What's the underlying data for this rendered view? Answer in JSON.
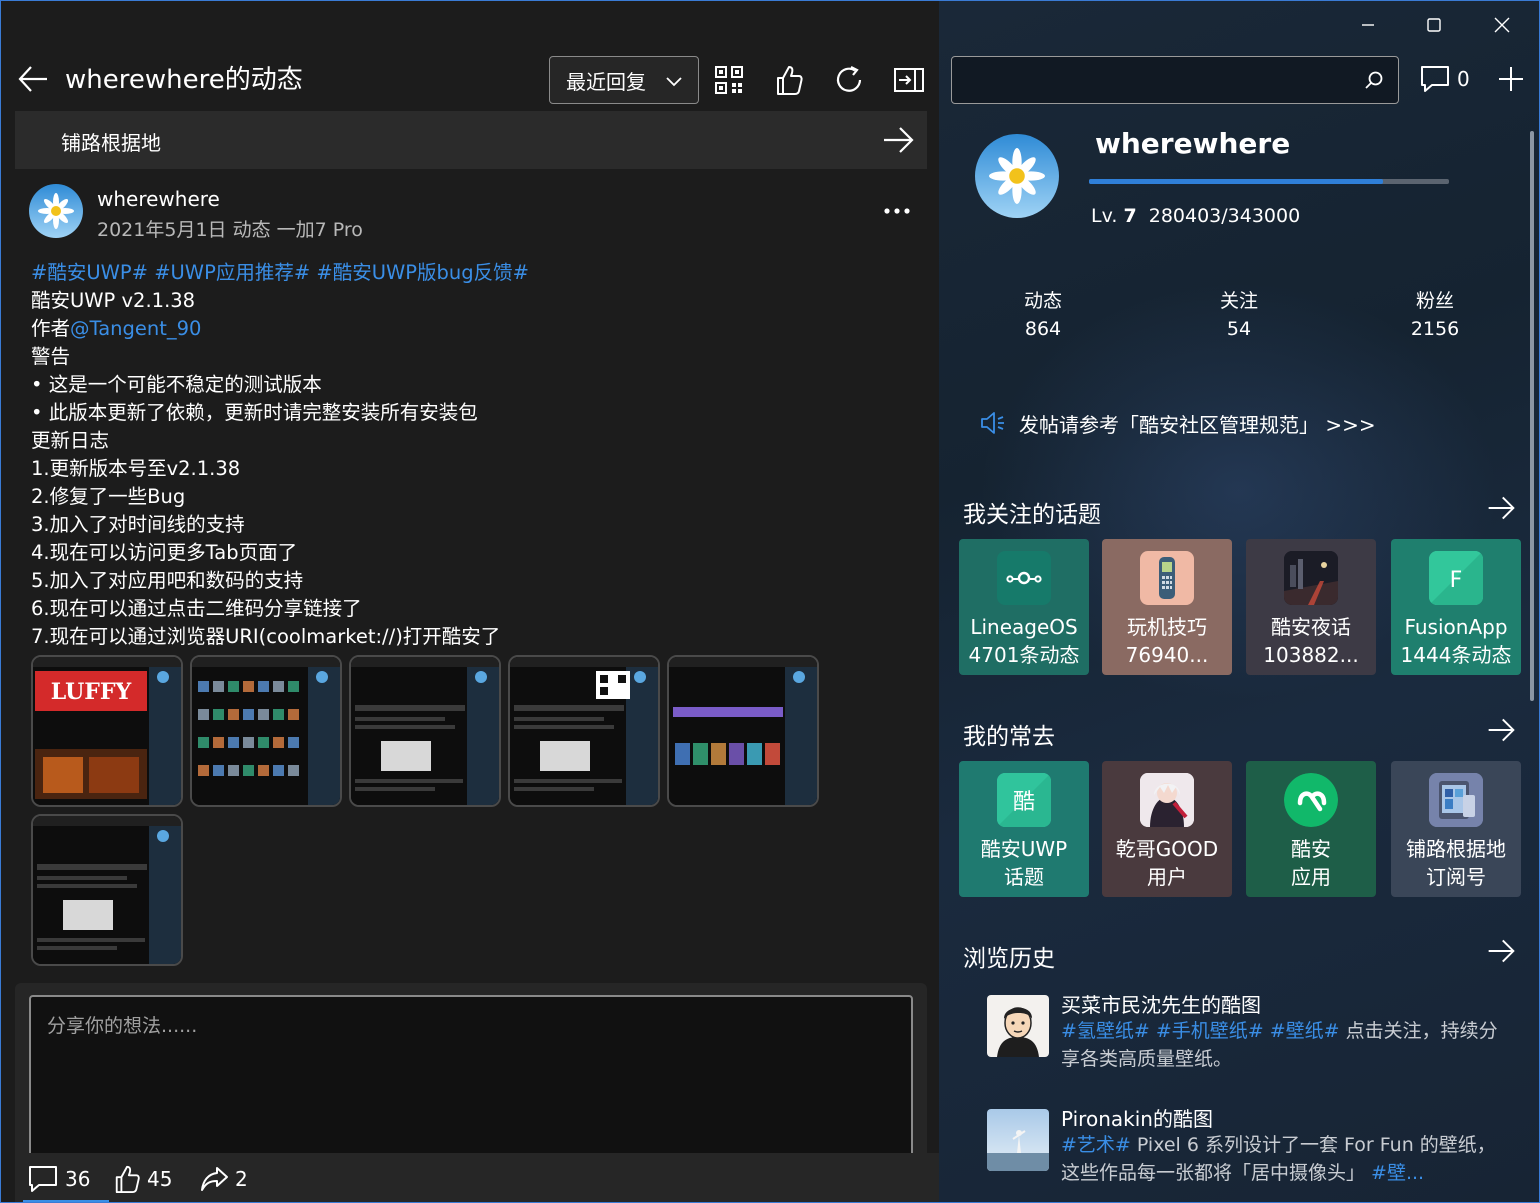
{
  "window": {
    "accent": "#3a7bd5",
    "controls": [
      "minimize",
      "maximize",
      "close"
    ]
  },
  "header": {
    "title": "wherewhere的动态",
    "sort_selected": "最近回复",
    "icons": [
      "back-arrow-icon",
      "qr-code-icon",
      "thumb-up-icon",
      "refresh-icon",
      "pane-toggle-icon"
    ]
  },
  "topic_bar": {
    "label": "铺路根据地"
  },
  "post": {
    "username": "wherewhere",
    "meta": "2021年5月1日  动态  一加7 Pro",
    "tags_line": "#酷安UWP# #UWP应用推荐# #酷安UWP版bug反馈#",
    "line_version": "酷安UWP v2.1.38",
    "author_prefix": "作者",
    "author_mention": "@Tangent_90",
    "lines": [
      "警告",
      "• 这是一个可能不稳定的测试版本",
      "• 此版本更新了依赖，更新时请完整安装所有安装包",
      "更新日志",
      "1.更新版本号至v2.1.38",
      "2.修复了一些Bug",
      "3.加入了对时间线的支持",
      "4.现在可以访问更多Tab页面了",
      "5.加入了对应用吧和数码的支持",
      "6.现在可以通过点击二维码分享链接了",
      "7.现在可以通过浏览器URI(coolmarket://)打开酷安了"
    ],
    "thumbnail_count": 6
  },
  "comment": {
    "placeholder": "分享你的想法......"
  },
  "bottom_bar": {
    "comments": "36",
    "likes": "45",
    "shares": "2"
  },
  "right": {
    "search_placeholder": "",
    "message_count": "0",
    "profile": {
      "name": "wherewhere",
      "level_label": "Lv.",
      "level": "7",
      "exp": "280403/343000",
      "exp_fraction": 0.8175
    },
    "stats": [
      {
        "label": "动态",
        "value": "864"
      },
      {
        "label": "关注",
        "value": "54"
      },
      {
        "label": "粉丝",
        "value": "2156"
      }
    ],
    "notice": "发帖请参考「酷安社区管理规范」 >>>",
    "followed_topics": {
      "title": "我关注的话题",
      "items": [
        {
          "line1": "LineageOS",
          "line2": "4701条动态",
          "color": "#1f6e64"
        },
        {
          "line1": "玩机技巧",
          "line2": "76940...",
          "color": "#8a6a62"
        },
        {
          "line1": "酷安夜话",
          "line2": "103882...",
          "color": "#3d3a45"
        },
        {
          "line1": "FusionApp",
          "line2": "1444条动态",
          "color": "#1f7f6e"
        }
      ]
    },
    "frequent": {
      "title": "我的常去",
      "items": [
        {
          "line1": "酷安UWP",
          "line2": "话题",
          "color": "#1f7a70"
        },
        {
          "line1": "乾哥GOOD",
          "line2": "用户",
          "color": "#4a3a3e"
        },
        {
          "line1": "酷安",
          "line2": "应用",
          "color": "#1e5e48"
        },
        {
          "line1": "铺路根据地",
          "line2": "订阅号",
          "color": "#3a4658"
        }
      ]
    },
    "history": {
      "title": "浏览历史",
      "items": [
        {
          "title": "买菜市民沈先生的酷图",
          "tags": "#氢壁纸# #手机壁纸# #壁纸#",
          "desc": " 点击关注，持续分享各类高质量壁纸。"
        },
        {
          "title": "Pironakin的酷图",
          "tags": "#艺术#",
          "desc": " Pixel 6 系列设计了一套 For Fun 的壁纸，这些作品每一张都将「居中摄像头」",
          "tags2": " #壁..."
        }
      ]
    }
  }
}
